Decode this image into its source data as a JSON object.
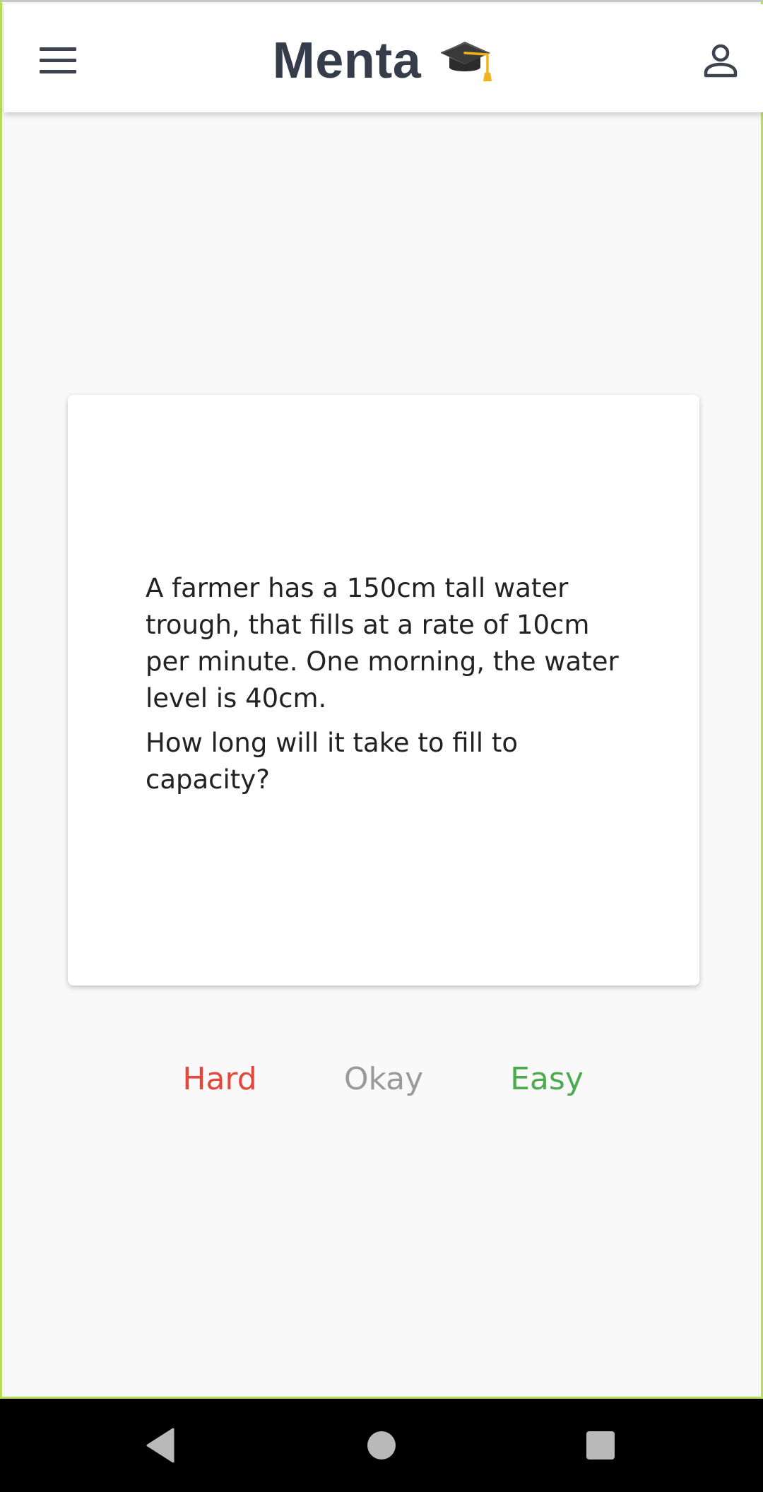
{
  "app_bar": {
    "title": "Menta",
    "title_emoji": "graduation-cap",
    "menu_icon": "hamburger-menu-icon",
    "profile_icon": "person-icon"
  },
  "card": {
    "question_paragraphs": [
      "A farmer has a 150cm tall water trough, that fills at a rate of 10cm per minute. One morning, the water level is 40cm.",
      "How long will it take to fill to capacity?"
    ]
  },
  "rating": {
    "hard_label": "Hard",
    "okay_label": "Okay",
    "easy_label": "Easy"
  },
  "system_nav": {
    "back_icon": "back-triangle-icon",
    "home_icon": "home-circle-icon",
    "recents_icon": "recents-square-icon"
  },
  "colors": {
    "title_text": "#353d4a",
    "hard": "#e5483b",
    "okay": "#9a9a9a",
    "easy": "#4caa4f",
    "frame_accent": "#b7dd5b",
    "background": "#f9f9f9"
  }
}
